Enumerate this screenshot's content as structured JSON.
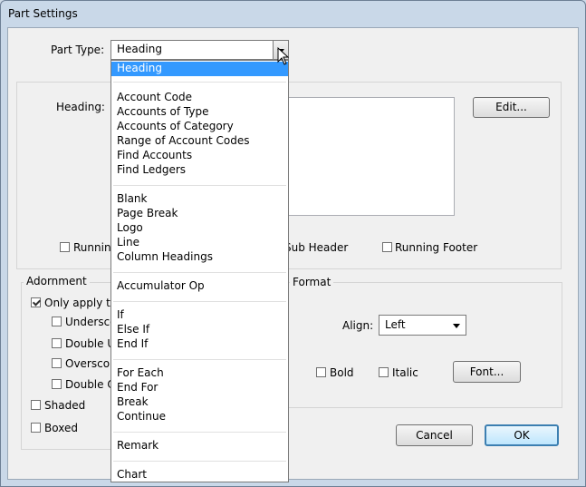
{
  "window": {
    "title": "Part Settings"
  },
  "part_type": {
    "label": "Part Type:",
    "value": "Heading"
  },
  "heading_label": "Heading:",
  "edit_button": "Edit...",
  "checkboxes_row": {
    "running": "Running",
    "sub_header": "Sub Header",
    "running_footer": "Running Footer"
  },
  "adornment": {
    "legend": "Adornment",
    "only_apply": "Only apply to",
    "underscore": "Undersco",
    "double_underscore": "Double U",
    "overscore": "Oversco",
    "double_overscore": "Double O",
    "shaded": "Shaded",
    "boxed": "Boxed"
  },
  "format": {
    "legend": "Format",
    "align_label": "Align:",
    "align_value": "Left",
    "bold": "Bold",
    "italic": "Italic",
    "font_button": "Font..."
  },
  "buttons": {
    "cancel": "Cancel",
    "ok": "OK"
  },
  "dropdown": {
    "items": [
      {
        "label": "Heading",
        "selected": true
      },
      {
        "label": "Account Code"
      },
      {
        "label": "Accounts of Type"
      },
      {
        "label": "Accounts of Category"
      },
      {
        "label": "Range of Account Codes"
      },
      {
        "label": "Find Accounts"
      },
      {
        "label": "Find Ledgers"
      },
      {
        "label": "Blank"
      },
      {
        "label": "Page Break"
      },
      {
        "label": "Logo"
      },
      {
        "label": "Line"
      },
      {
        "label": "Column Headings"
      },
      {
        "label": "Accumulator Op"
      },
      {
        "label": "If"
      },
      {
        "label": "Else If"
      },
      {
        "label": "End If"
      },
      {
        "label": "For Each"
      },
      {
        "label": "End For"
      },
      {
        "label": "Break"
      },
      {
        "label": "Continue"
      },
      {
        "label": "Remark"
      },
      {
        "label": "Chart"
      }
    ]
  },
  "colors": {
    "selection": "#3399ff",
    "window_frame": "#c9d8e8",
    "default_button": "#3c7fb1"
  }
}
